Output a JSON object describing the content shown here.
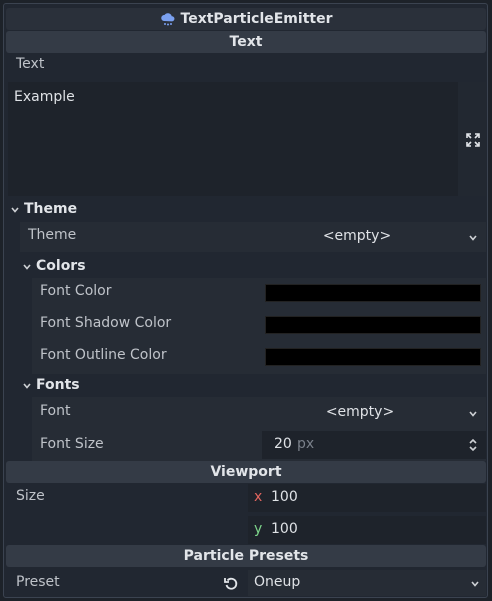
{
  "title": "TextParticleEmitter",
  "sections": {
    "text": {
      "header": "Text",
      "label": "Text",
      "value": "Example"
    },
    "theme": {
      "group": "Theme",
      "theme_label": "Theme",
      "theme_value": "<empty>",
      "colors_group": "Colors",
      "font_color_label": "Font Color",
      "font_shadow_color_label": "Font Shadow Color",
      "font_outline_color_label": "Font Outline Color",
      "font_color": "#000000",
      "font_shadow_color": "#000000",
      "font_outline_color": "#000000",
      "fonts_group": "Fonts",
      "font_label": "Font",
      "font_value": "<empty>",
      "font_size_label": "Font Size",
      "font_size_value": "20",
      "font_size_unit": "px"
    },
    "viewport": {
      "header": "Viewport",
      "size_label": "Size",
      "x_axis": "x",
      "x_value": "100",
      "y_axis": "y",
      "y_value": "100"
    },
    "presets": {
      "header": "Particle Presets",
      "preset_label": "Preset",
      "preset_value": "Oneup"
    }
  },
  "colors": {
    "accent": "#6b8cff",
    "x_axis": "#e0655f",
    "y_axis": "#7dd48a"
  },
  "icons": [
    "cloud-icon",
    "expand-icon",
    "chevron-down-icon",
    "chevron-updown-icon",
    "revert-icon"
  ]
}
